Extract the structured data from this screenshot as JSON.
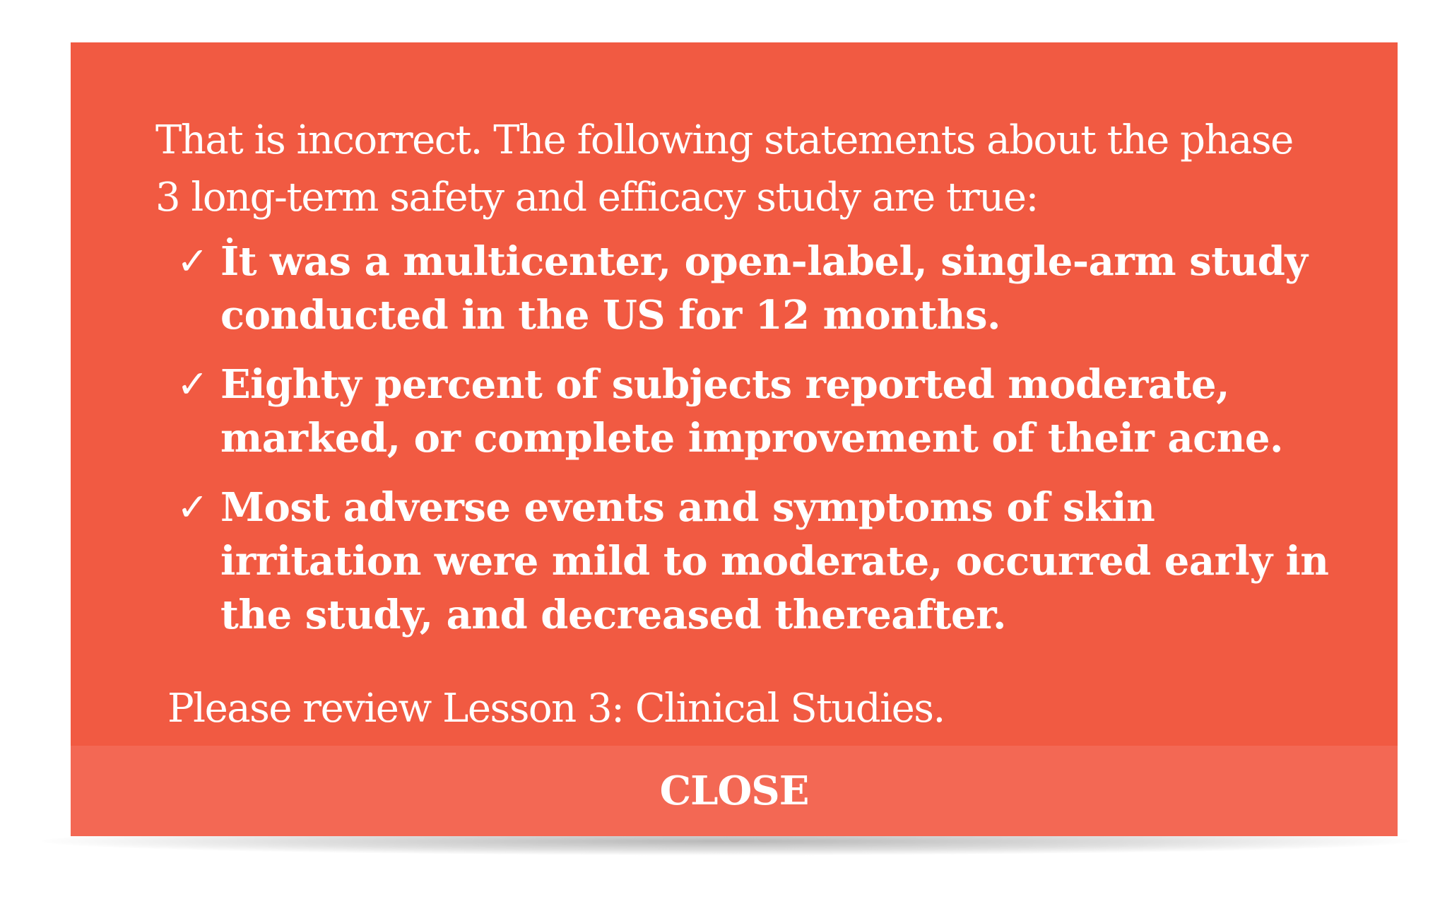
{
  "feedback": {
    "intro": "That is incorrect. The following statements about the phase 3 long-term safety and efficacy study are true:",
    "check_symbol": "✓",
    "items": [
      {
        "text": "İt was a multicenter, open-label, single-arm study conducted in the US for 12 months."
      },
      {
        "text": "Eighty percent of subjects reported moderate, marked, or complete improvement of their acne."
      },
      {
        "text": "Most adverse events and symptoms of skin irritation were mild to moderate, occurred early in the study, and decreased thereafter."
      }
    ],
    "review": "Please review Lesson 3: Clinical Studies.",
    "close_label": "CLOSE"
  },
  "colors": {
    "dialog_background": "#f15a42",
    "close_bar_background": "#f36854",
    "text": "#ffffff"
  }
}
